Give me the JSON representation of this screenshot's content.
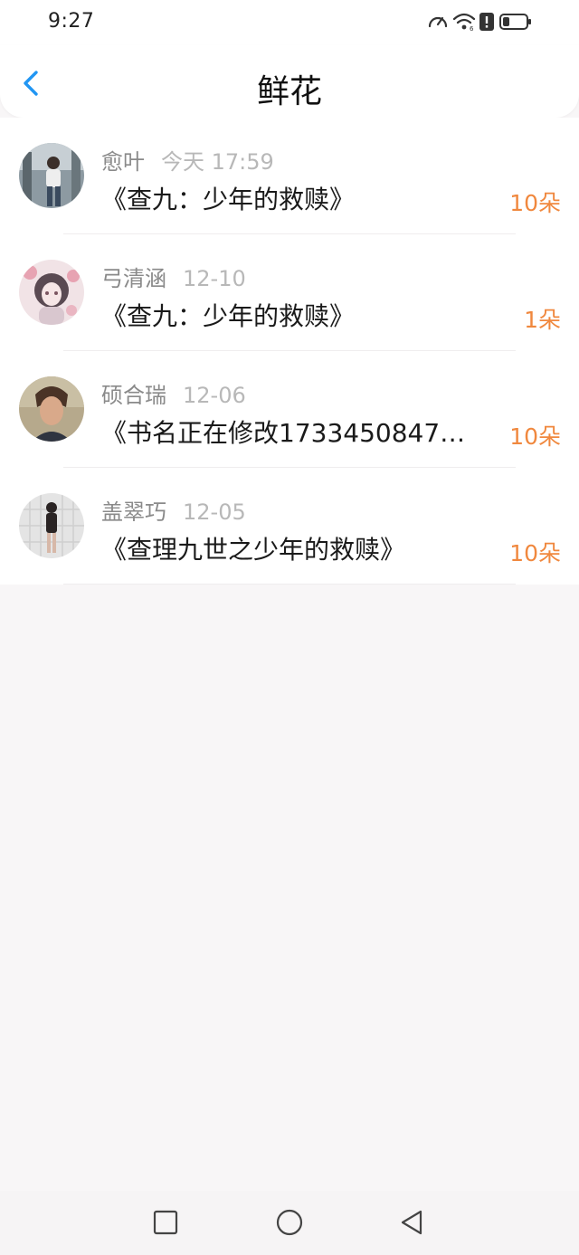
{
  "status_bar": {
    "time": "9:27",
    "icons": [
      "speed-icon",
      "wifi-icon",
      "alert-icon",
      "battery-icon"
    ]
  },
  "header": {
    "title": "鲜花",
    "back_icon": "chevron-left-icon"
  },
  "colors": {
    "accent_blue": "#2196f3",
    "count_orange": "#f0883e"
  },
  "gifts": [
    {
      "name": "愈叶",
      "time": "今天 17:59",
      "book": "《查九：少年的救赎》",
      "count": "10朵"
    },
    {
      "name": "弓清涵",
      "time": "12-10",
      "book": "《查九：少年的救赎》",
      "count": "1朵"
    },
    {
      "name": "硕合瑞",
      "time": "12-06",
      "book": "《书名正在修改1733450847…",
      "count": "10朵"
    },
    {
      "name": "盖翠巧",
      "time": "12-05",
      "book": "《查理九世之少年的救赎》",
      "count": "10朵"
    }
  ],
  "nav_bar": {
    "buttons": [
      "recent-apps-icon",
      "home-icon",
      "back-icon"
    ]
  }
}
